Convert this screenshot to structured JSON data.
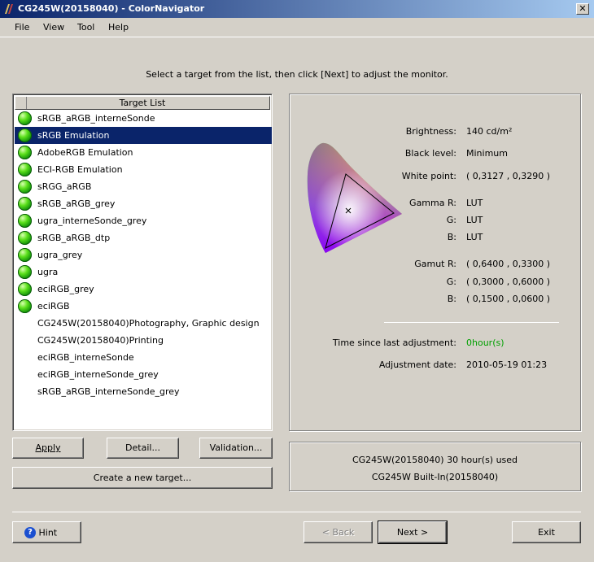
{
  "window": {
    "title": "CG245W(20158040) - ColorNavigator",
    "close_glyph": "✕"
  },
  "menu": {
    "file": "File",
    "view": "View",
    "tool": "Tool",
    "help": "Help"
  },
  "instruction": "Select a target from the list, then click [Next] to adjust the monitor.",
  "target_list": {
    "header": "Target List",
    "items": [
      {
        "label": "sRGB_aRGB_interneSonde",
        "icon": true,
        "selected": false
      },
      {
        "label": "sRGB Emulation",
        "icon": true,
        "selected": true
      },
      {
        "label": "AdobeRGB Emulation",
        "icon": true,
        "selected": false
      },
      {
        "label": "ECI-RGB Emulation",
        "icon": true,
        "selected": false
      },
      {
        "label": "sRGG_aRGB",
        "icon": true,
        "selected": false
      },
      {
        "label": "sRGB_aRGB_grey",
        "icon": true,
        "selected": false
      },
      {
        "label": "ugra_interneSonde_grey",
        "icon": true,
        "selected": false
      },
      {
        "label": "sRGB_aRGB_dtp",
        "icon": true,
        "selected": false
      },
      {
        "label": "ugra_grey",
        "icon": true,
        "selected": false
      },
      {
        "label": "ugra",
        "icon": true,
        "selected": false
      },
      {
        "label": "eciRGB_grey",
        "icon": true,
        "selected": false
      },
      {
        "label": "eciRGB",
        "icon": true,
        "selected": false
      },
      {
        "label": "CG245W(20158040)Photography, Graphic design",
        "icon": false,
        "selected": false
      },
      {
        "label": "CG245W(20158040)Printing",
        "icon": false,
        "selected": false
      },
      {
        "label": "eciRGB_interneSonde",
        "icon": false,
        "selected": false
      },
      {
        "label": "eciRGB_interneSonde_grey",
        "icon": false,
        "selected": false
      },
      {
        "label": "sRGB_aRGB_interneSonde_grey",
        "icon": false,
        "selected": false
      }
    ]
  },
  "buttons": {
    "apply": "Apply",
    "detail": "Detail...",
    "validation": "Validation...",
    "create": "Create a new target...",
    "hint": "Hint",
    "back": "< Back",
    "next": "Next >",
    "exit": "Exit"
  },
  "info": {
    "brightness_label": "Brightness:",
    "brightness_value": "140 cd/m²",
    "black_label": "Black level:",
    "black_value": "Minimum",
    "white_label": "White point:",
    "white_value": "( 0,3127 , 0,3290 )",
    "gamma_r_label": "Gamma R:",
    "gamma_r_value": "LUT",
    "gamma_g_label": "G:",
    "gamma_g_value": "LUT",
    "gamma_b_label": "B:",
    "gamma_b_value": "LUT",
    "gamut_r_label": "Gamut R:",
    "gamut_r_value": "( 0,6400 , 0,3300 )",
    "gamut_g_label": "G:",
    "gamut_g_value": "( 0,3000 , 0,6000 )",
    "gamut_b_label": "B:",
    "gamut_b_value": "( 0,1500 , 0,0600 )",
    "time_label": "Time since last adjustment:",
    "time_value": "0hour(s)",
    "date_label": "Adjustment date:",
    "date_value": "2010-05-19 01:23",
    "time_value_color": "#00a000"
  },
  "usage": {
    "line1": "CG245W(20158040) 30 hour(s) used",
    "line2": "CG245W Built-In(20158040)"
  }
}
